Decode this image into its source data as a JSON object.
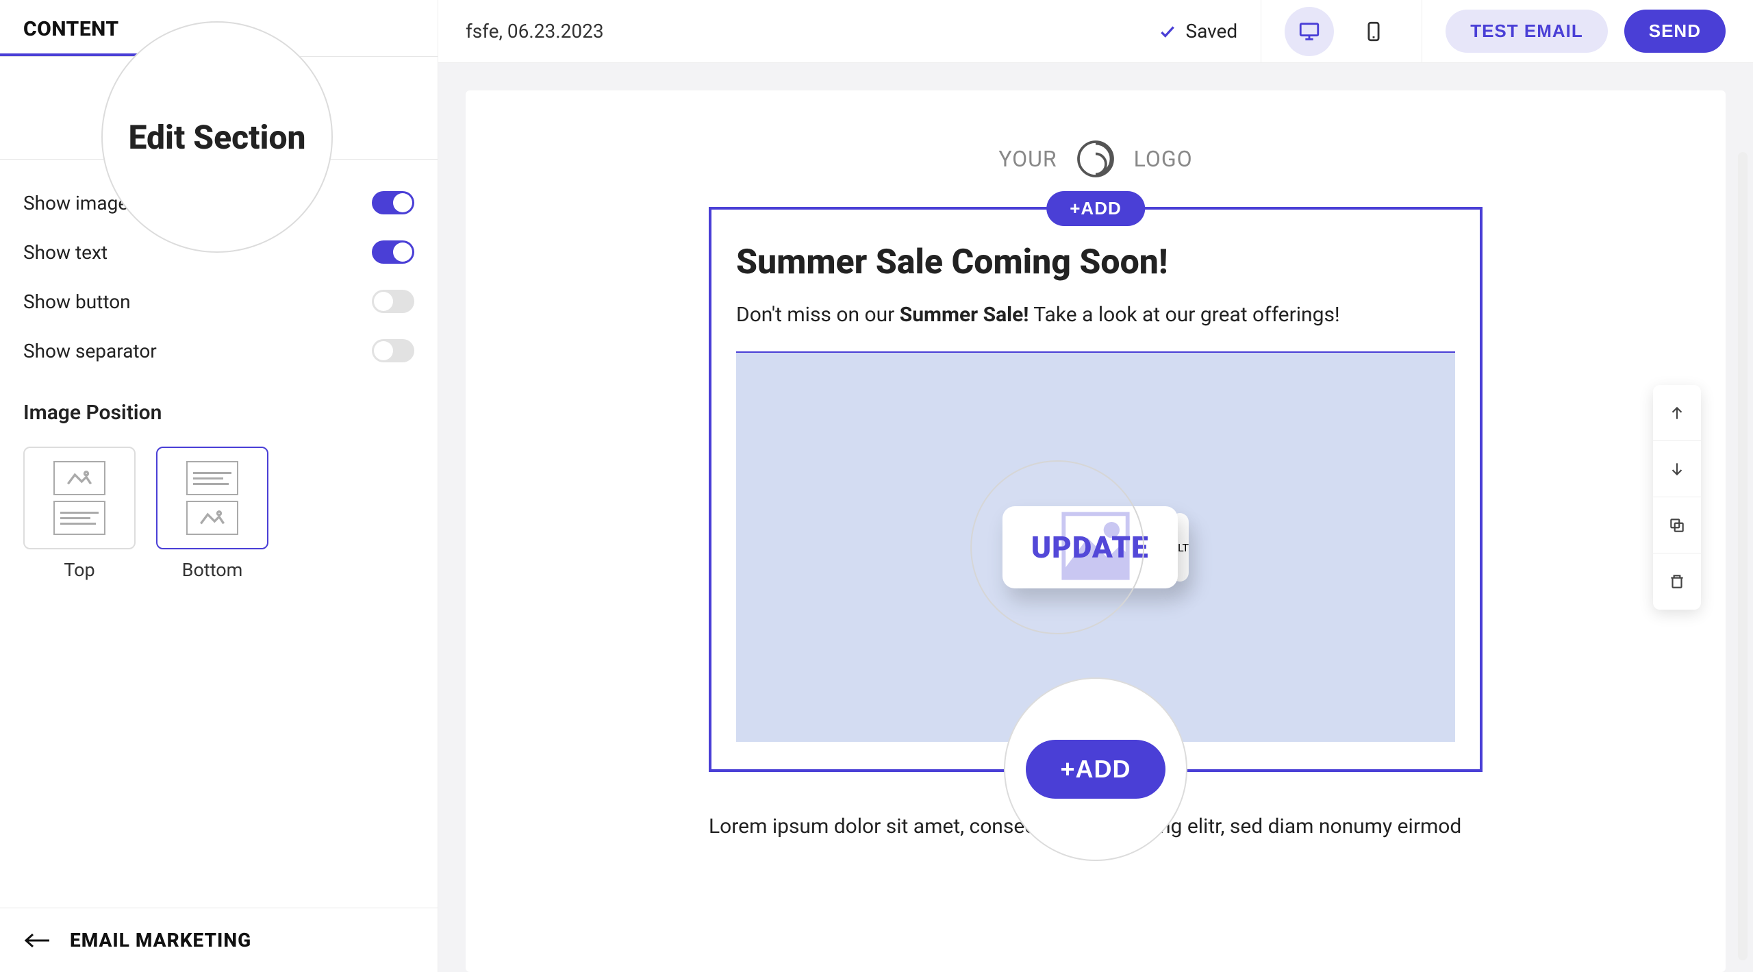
{
  "sidebar": {
    "tab": "CONTENT",
    "section_title": "Edit Section",
    "toggles": {
      "show_image": {
        "label": "Show image",
        "on": true
      },
      "show_text": {
        "label": "Show text",
        "on": true
      },
      "show_button": {
        "label": "Show button",
        "on": false
      },
      "show_separator": {
        "label": "Show separator",
        "on": false
      }
    },
    "image_position": {
      "label": "Image Position",
      "options": [
        "Top",
        "Bottom"
      ],
      "selected": "Bottom"
    },
    "footer": "EMAIL MARKETING"
  },
  "topbar": {
    "doc_name": "fsfe, 06.23.2023",
    "saved_label": "Saved",
    "test_email": "TEST EMAIL",
    "send": "SEND"
  },
  "canvas": {
    "logo_left": "YOUR",
    "logo_right": "LOGO",
    "add_label": "+ADD",
    "heading": "Summer Sale Coming Soon!",
    "body_pre": "Don't miss on our ",
    "body_bold": "Summer Sale!",
    "body_post": " Take a look at our great offerings!",
    "update_label": "UPDATE",
    "alt_label": "ALT",
    "add_bottom_label": "+ADD",
    "lorem": "Lorem ipsum dolor sit amet, consectetur sadipscing elitr, sed diam nonumy eirmod"
  }
}
